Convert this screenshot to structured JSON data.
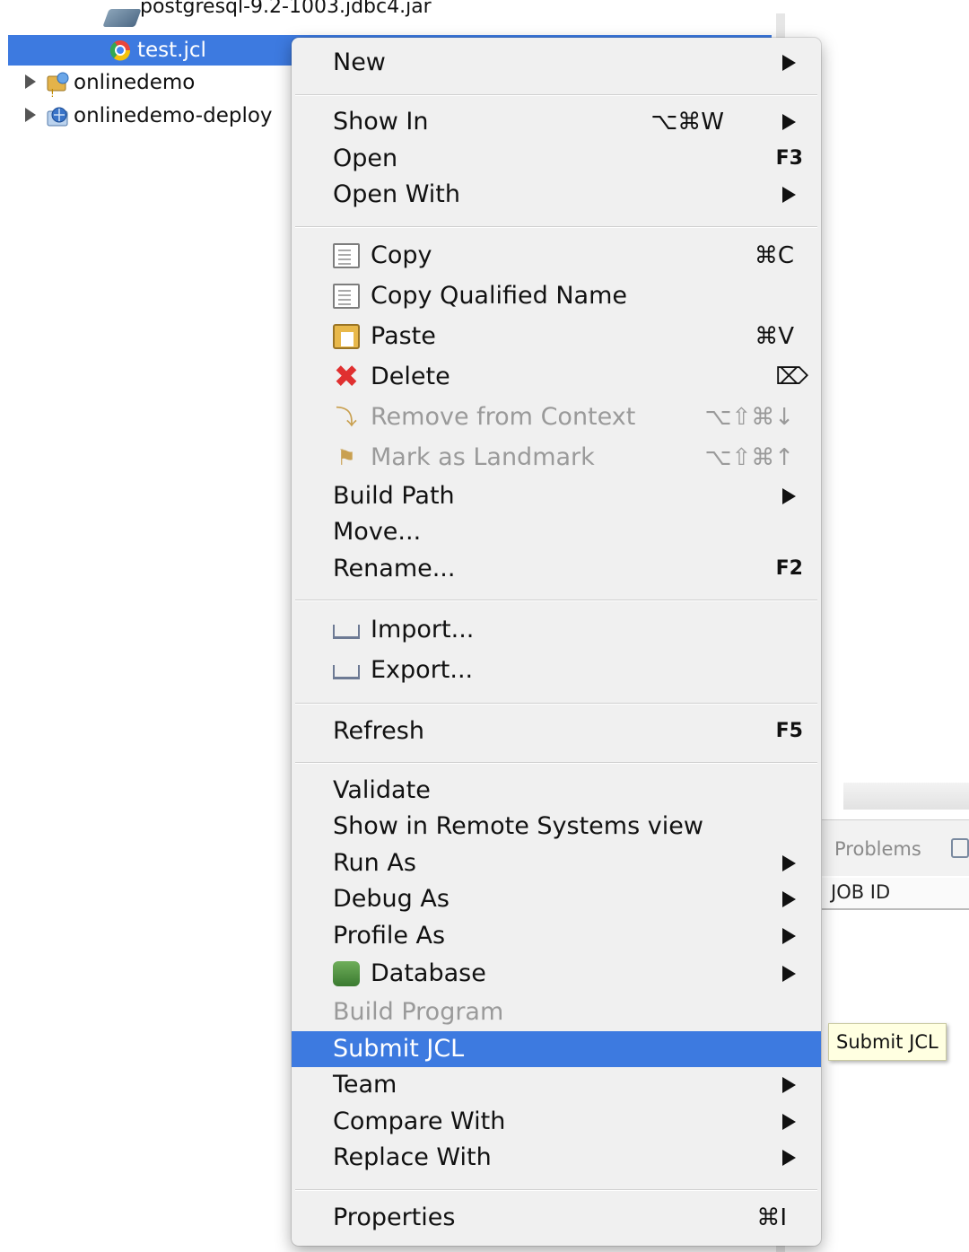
{
  "tree": {
    "items": [
      {
        "label": "postgresql-9.2-1003.jdbc4.jar",
        "icon": "jar-icon"
      },
      {
        "label": "test.jcl",
        "icon": "jcl-file-icon",
        "selected": true
      },
      {
        "label": "onlinedemo",
        "icon": "project-icon"
      },
      {
        "label": "onlinedemo-deploy",
        "icon": "deploy-project-icon"
      }
    ]
  },
  "menu": {
    "new": {
      "label": "New"
    },
    "show_in": {
      "label": "Show In",
      "shortcut": "⌥⌘W"
    },
    "open": {
      "label": "Open",
      "shortcut": "F3"
    },
    "open_with": {
      "label": "Open With"
    },
    "copy": {
      "label": "Copy",
      "shortcut": "⌘C"
    },
    "copy_qualified": {
      "label": "Copy Qualified Name"
    },
    "paste": {
      "label": "Paste",
      "shortcut": "⌘V"
    },
    "delete": {
      "label": "Delete",
      "shortcut": "⌦"
    },
    "remove_context": {
      "label": "Remove from Context",
      "shortcut": "⌥⇧⌘↓"
    },
    "mark_landmark": {
      "label": "Mark as Landmark",
      "shortcut": "⌥⇧⌘↑"
    },
    "build_path": {
      "label": "Build Path"
    },
    "move": {
      "label": "Move..."
    },
    "rename": {
      "label": "Rename...",
      "shortcut": "F2"
    },
    "import": {
      "label": "Import..."
    },
    "export": {
      "label": "Export..."
    },
    "refresh": {
      "label": "Refresh",
      "shortcut": "F5"
    },
    "validate": {
      "label": "Validate"
    },
    "show_remote": {
      "label": "Show in Remote Systems view"
    },
    "run_as": {
      "label": "Run As"
    },
    "debug_as": {
      "label": "Debug As"
    },
    "profile_as": {
      "label": "Profile As"
    },
    "database": {
      "label": "Database"
    },
    "build_program": {
      "label": "Build Program"
    },
    "submit_jcl": {
      "label": "Submit JCL"
    },
    "team": {
      "label": "Team"
    },
    "compare_with": {
      "label": "Compare With"
    },
    "replace_with": {
      "label": "Replace With"
    },
    "properties": {
      "label": "Properties",
      "shortcut": "⌘I"
    }
  },
  "panel": {
    "tab": "Problems",
    "column": "JOB ID"
  },
  "tooltip": {
    "text": "Submit JCL"
  },
  "colors": {
    "selection": "#3d7ae0",
    "menu_bg": "#f0f0f0",
    "disabled": "#9a9a9a",
    "tooltip_bg": "#ffffe1"
  }
}
